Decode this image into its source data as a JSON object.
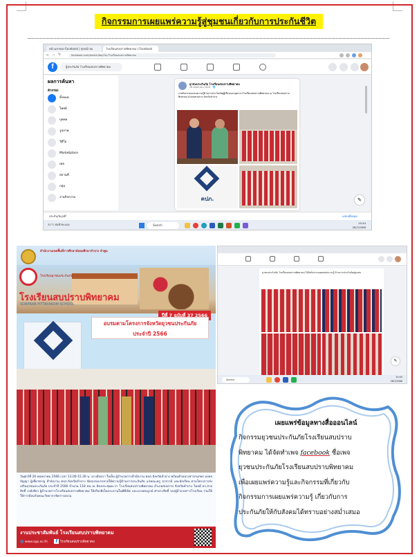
{
  "heading": "กิจกรรมการเผยแพร่ความรู้สู่ชุมชนเกี่ยวกับการประกันชีวิต",
  "colors": {
    "frame": "#d2262c",
    "highlight": "#fff200",
    "facebook_blue": "#1877f2",
    "school_red": "#d9262e",
    "callout_blue": "#4f8fd4"
  },
  "screenshot1": {
    "tabs": [
      "หน้าแรกของ Facebook | ทุกหน้าจอ",
      "โรงเรียนสบปราบพิทยาคม | Facebook"
    ],
    "url": "facebook.com/search/top/?q=โรงเรียนสบปราบพิทยาคม",
    "fb_logo": "f",
    "search_value": "ผู้ประกันภัย โรงเรียนสบปราบพิทยาคม",
    "sidebar": {
      "heading": "ผลการค้นหา",
      "filter_label": "ตัวกรอง",
      "items": [
        "ทั้งหมด",
        "โพสต์",
        "บุคคล",
        "รูปภาพ",
        "วิดีโอ",
        "Marketplace",
        "เพจ",
        "สถานที่",
        "กลุ่ม",
        "งานกิจกรรม"
      ]
    },
    "post": {
      "author": "ยุวชนประกันภัย โรงเรียนสบปราบพิทยาคม",
      "date": "26 พฤษภาคม 2023 · 🌐",
      "text": "ภาพกิจกรรมอบรมความรู้ด้านการประกันภัยสู่ผู้เรียนและบุคลากรโรงเรียนสบปราบพิทยาคม ณ โรงเรียนสบปราบพิทยาคม อำเภอสบปราบ จังหวัดลำปาง",
      "logo_text": "คปภ."
    },
    "download_file": "ประกันภัย.pdf",
    "show_all": "แสดงทั้งหมด",
    "taskbar": {
      "weather": "31°C ฝนฟ้าคะนอง",
      "search": "Search",
      "time": "15:44",
      "date": "28/7/2566"
    }
  },
  "poster": {
    "top_line": "สำนักงานเขตพื้นที่การศึกษามัธยมศึกษาลำปาง ลำพูน",
    "tagline": "โรงเรียนยุวชนประกันภัย",
    "school_name": "โรงเรียนสบปราบพิทยาคม",
    "school_name_en": "SOBPRAB PITTAYAKOM SCHOOL",
    "issue": "ปีที่ 7 ฉบับที่ 37 2566",
    "banner_line1": "อบรมตามโครงการจังหวัดยุวชนประกันภัย",
    "banner_line2": "ประจำปี 2566",
    "caption": "วันศุกร์ที่ 26 พฤษภาคม 2566 เวลา 13.00-15.30 น. นางอัจฉรา ใจเย็น ผู้อำนวยการสำนักงาน คปภ.จังหวัดลำปาง พร้อมด้วยนางสาวกนกพร มงคลปัญญา ผู้เชี่ยวชาญ สำนักงาน คปภ.จังหวัดลำปาง จัดอบรมบรรยายให้ความรู้ด้านการประกันภัย แก่คณะครู อาจารย์ และนักเรียน ตามโครงการส่งเสริมยุวชนประกันภัย ประจำปี 2566 จำนวน 118 คน ณ ห้องประชุมตะวา โรงเรียนสบปราบพิทยาคม อำเภอสบปราบ จังหวัดลำปาง โดยมี ดร.สายสิทธิ์ วงค์เขียว ผู้อำนวยการโรงเรียนสบปราบพิทยาคม ให้เกียรติเป็นประธานในพิธีเปิด และนายสมบูรณ์ ศาประสิทธิ์ รองผู้อำนวยการโรงเรียน ร่วมให้ให้การต้อนรับคณะวิทยากรจัดการอบรม",
    "footer_title": "งานประชาสัมพันธ์ โรงเรียนสบปราบพิทยาคม",
    "footer_web": "www.spp.ac.th",
    "footer_fb": "โรงเรียนสบปราบพิทยาคม"
  },
  "screenshot2": {
    "time": "15:45",
    "date": "28/7/2566",
    "search": "Search",
    "post_text": "ยุวชนประกันภัย โรงเรียนสบปราบพิทยาคม ได้จัดกิจกรรมเผยแพร่ความรู้ ด้านการประกันภัยสู่ชุมชน"
  },
  "callout": {
    "title": "เผยแพร่ข้อมูลทางสื่อออนไลน์",
    "lines": [
      "กิจกรรมยุวชนประกันภัยโรงเรียนสบปราบ",
      "พิทยาคม ได้จัดทำเพจ ",
      "facebook",
      " ชื่อเพจ",
      "ยุวชนประกันภัยโรงเรียนสบปราบพิทยาคม",
      "เพื่อเผยแพร่ความรู้และกิจกรรมที่เกี่ยวกับ",
      "กิจกรรมการเผยแพร่ความรู้ เกี่ยวกับการ",
      "ประกันภัยให้กับสังคมได้ทราบอย่างสม่ำเสมอ"
    ]
  }
}
